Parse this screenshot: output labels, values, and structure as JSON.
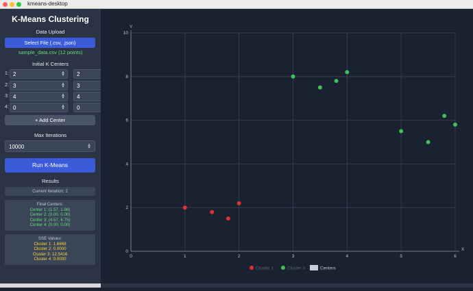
{
  "window": {
    "title": "kmeans-desktop"
  },
  "sidebar": {
    "app_title": "K-Means Clustering",
    "data_upload_label": "Data Upload",
    "select_file_label": "Select File (.csv, .json)",
    "file_info": "sample_data.csv (12 points)",
    "initial_centers_label": "Initial K Centers",
    "centers": [
      {
        "index": "1:",
        "x": "2",
        "y": "2"
      },
      {
        "index": "2:",
        "x": "3",
        "y": "3"
      },
      {
        "index": "3:",
        "x": "4",
        "y": "4"
      },
      {
        "index": "4:",
        "x": "0",
        "y": "0"
      }
    ],
    "remove_label": "×",
    "add_center_label": "+ Add Center",
    "max_iterations_label": "Max Iterations",
    "max_iterations_value": "10000",
    "run_label": "Run K-Means",
    "results_label": "Results",
    "current_iteration": "Current Iteration: 2",
    "final_centers_title": "Final Centers:",
    "final_centers": [
      "Center 1: (1.57, 1.88)",
      "Center 2: (0.00, 0.00)",
      "Center 3: (4.57, 6.75)",
      "Center 4: (0.00, 0.00)"
    ],
    "sse_title": "SSE Values:",
    "sse_values": [
      "Cluster 1: 1.6668",
      "Cluster 2: 0.0000",
      "Cluster 3: 12.5416",
      "Cluster 4: 0.0000"
    ]
  },
  "chart_data": {
    "type": "scatter",
    "xlabel": "X",
    "ylabel": "Y",
    "xlim": [
      0,
      6
    ],
    "ylim": [
      0,
      10
    ],
    "xticks": [
      0,
      1,
      2,
      3,
      4,
      5,
      6
    ],
    "yticks": [
      0,
      2,
      4,
      6,
      8,
      10
    ],
    "grid": true,
    "legend_position": "bottom",
    "series": [
      {
        "name": "Cluster 1",
        "color": "#e03131",
        "points": [
          [
            1,
            2
          ],
          [
            1.5,
            1.8
          ],
          [
            1.8,
            1.5
          ],
          [
            2,
            2.2
          ]
        ]
      },
      {
        "name": "Cluster 3",
        "color": "#40c057",
        "points": [
          [
            3,
            8
          ],
          [
            3.5,
            7.5
          ],
          [
            3.8,
            7.8
          ],
          [
            4,
            8.2
          ],
          [
            5,
            5.5
          ],
          [
            5.5,
            5
          ],
          [
            5.8,
            6.2
          ],
          [
            6,
            5.8
          ]
        ]
      }
    ],
    "centers_legend": "Centers",
    "centers_legend_color": "#c9ced6"
  }
}
